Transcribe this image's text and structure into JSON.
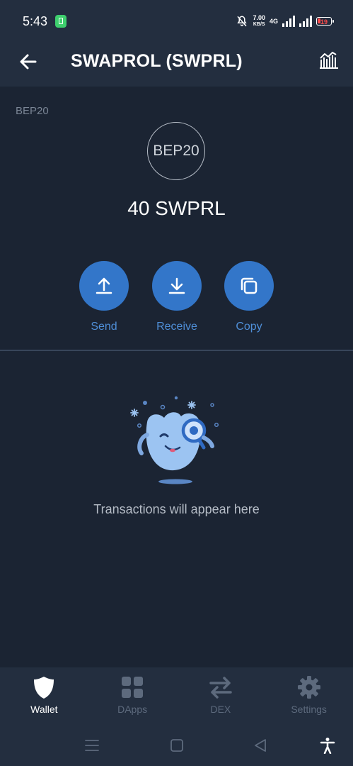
{
  "status_bar": {
    "time": "5:43",
    "speed_value": "7.00",
    "speed_unit": "KB/S",
    "network": "4G",
    "battery": "19"
  },
  "header": {
    "title": "SWAPROL (SWPRL)",
    "back_icon": "arrow-left-icon",
    "chart_icon": "chart-icon"
  },
  "token": {
    "standard": "BEP20",
    "logo_text": "BEP20",
    "balance": "40 SWPRL"
  },
  "actions": [
    {
      "label": "Send",
      "icon": "upload-icon"
    },
    {
      "label": "Receive",
      "icon": "download-icon"
    },
    {
      "label": "Copy",
      "icon": "copy-icon"
    }
  ],
  "transactions": {
    "empty_text": "Transactions will appear here"
  },
  "bottom_nav": [
    {
      "label": "Wallet",
      "icon": "shield-icon",
      "active": true
    },
    {
      "label": "DApps",
      "icon": "grid-icon",
      "active": false
    },
    {
      "label": "DEX",
      "icon": "swap-arrows-icon",
      "active": false
    },
    {
      "label": "Settings",
      "icon": "gear-icon",
      "active": false
    }
  ],
  "colors": {
    "background": "#1b2433",
    "bar": "#232e3f",
    "accent": "#3376c9",
    "accent_text": "#4f8fd8"
  }
}
